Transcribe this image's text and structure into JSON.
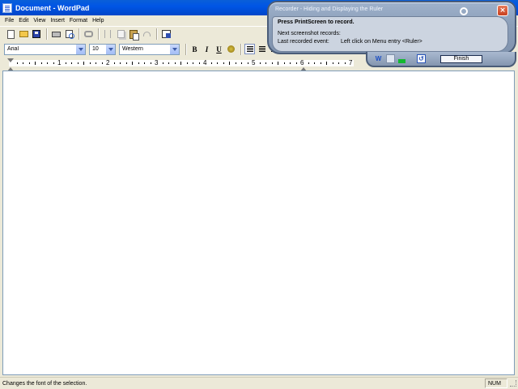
{
  "window": {
    "title": "Document - WordPad"
  },
  "menu": {
    "items": [
      "File",
      "Edit",
      "View",
      "Insert",
      "Format",
      "Help"
    ]
  },
  "toolbar": {
    "buttons": [
      "new-icon",
      "open-icon",
      "save-icon",
      "print-icon",
      "print-preview-icon",
      "find-icon",
      "cut-icon",
      "copy-icon",
      "paste-icon",
      "undo-icon",
      "date-time-icon"
    ]
  },
  "format_bar": {
    "font": "Arial",
    "size": "10",
    "script": "Western",
    "bold": "B",
    "italic": "I",
    "underline": "U"
  },
  "ruler": {
    "numbers": [
      "1",
      "2",
      "3",
      "4",
      "5",
      "6",
      "7"
    ]
  },
  "status_bar": {
    "text": "Changes the font of the selection.",
    "num": "NUM"
  },
  "recorder": {
    "title": "Recorder - Hiding and Displaying the Ruler",
    "instruction": "Press PrintScreen to record.",
    "next_label": "Next screenshot records:",
    "next_value": "",
    "last_label": "Last recorded event:",
    "last_value": "Left click on Menu entry <Ruler>",
    "finish_label": "Finish",
    "close_glyph": "×",
    "word_glyph": "W",
    "refresh_glyph": "↺"
  },
  "colors": {
    "titlebar": "#0055e5",
    "chrome": "#ece9d8",
    "recorder_shell": "#8b9eb8",
    "recorder_panel": "#ccd4e0"
  }
}
